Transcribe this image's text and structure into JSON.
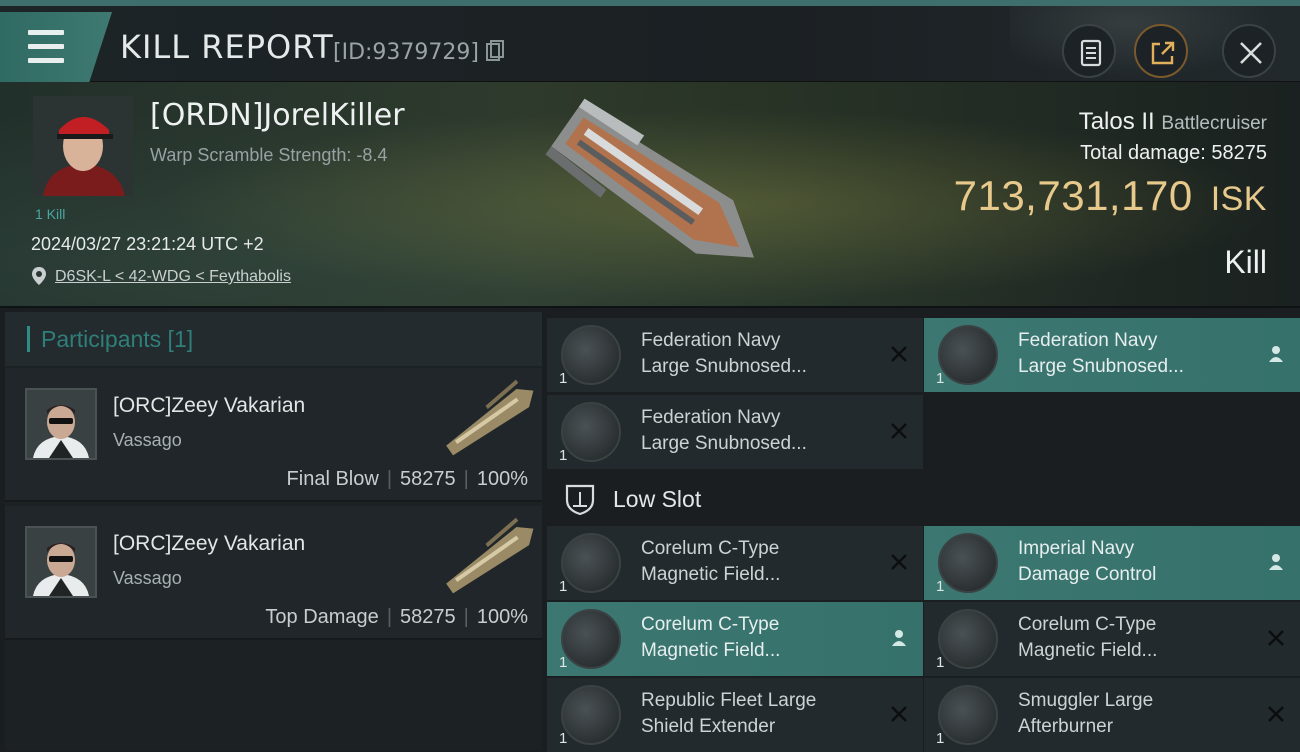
{
  "header": {
    "title": "KILL REPORT",
    "report_id": "[ID:9379729]"
  },
  "victim": {
    "name": "[ORDN]JorelKiller",
    "warp_scramble": "Warp Scramble Strength: -8.4",
    "kills": "1 Kill",
    "datetime": "2024/03/27 23:21:24 UTC +2",
    "location": "D6SK-L < 42-WDG < Feythabolis",
    "ship_name": "Talos II",
    "ship_class": "Battlecruiser",
    "total_damage_label": "Total damage:",
    "total_damage": "58275",
    "isk_value": "713,731,170",
    "isk_unit": "ISK",
    "kill_type": "Kill"
  },
  "participants": {
    "label": "Participants [1]",
    "rows": [
      {
        "name": "[ORC]Zeey Vakarian",
        "ship": "Vassago",
        "role": "Final Blow",
        "damage": "58275",
        "percent": "100%"
      },
      {
        "name": "[ORC]Zeey Vakarian",
        "ship": "Vassago",
        "role": "Top Damage",
        "damage": "58275",
        "percent": "100%"
      }
    ]
  },
  "modules": {
    "low_slot_label": "Low Slot",
    "items": [
      {
        "line1": "Federation Navy",
        "line2": "Large Snubnosed...",
        "qty": "1",
        "status": "destroyed"
      },
      {
        "line1": "Federation Navy",
        "line2": "Large Snubnosed...",
        "qty": "1",
        "status": "dropped"
      },
      {
        "line1": "Federation Navy",
        "line2": "Large Snubnosed...",
        "qty": "1",
        "status": "destroyed"
      },
      {
        "line1": "Corelum C-Type",
        "line2": "Magnetic Field...",
        "qty": "1",
        "status": "destroyed"
      },
      {
        "line1": "Imperial Navy",
        "line2": "Damage Control",
        "qty": "1",
        "status": "dropped"
      },
      {
        "line1": "Corelum C-Type",
        "line2": "Magnetic Field...",
        "qty": "1",
        "status": "dropped"
      },
      {
        "line1": "Corelum C-Type",
        "line2": "Magnetic Field...",
        "qty": "1",
        "status": "destroyed"
      },
      {
        "line1": "Republic Fleet Large",
        "line2": "Shield Extender",
        "qty": "1",
        "status": "destroyed"
      },
      {
        "line1": "Smuggler Large",
        "line2": "Afterburner",
        "qty": "1",
        "status": "destroyed"
      }
    ]
  },
  "colors": {
    "accent_teal": "#3c7771",
    "isk_gold": "#e7c98b",
    "participants_teal": "#2e7f79"
  },
  "icons": [
    "menu-icon",
    "copy-icon",
    "clipboard-icon",
    "share-icon",
    "close-icon",
    "location-pin-icon",
    "shield-icon",
    "remove-x-icon",
    "person-icon"
  ]
}
